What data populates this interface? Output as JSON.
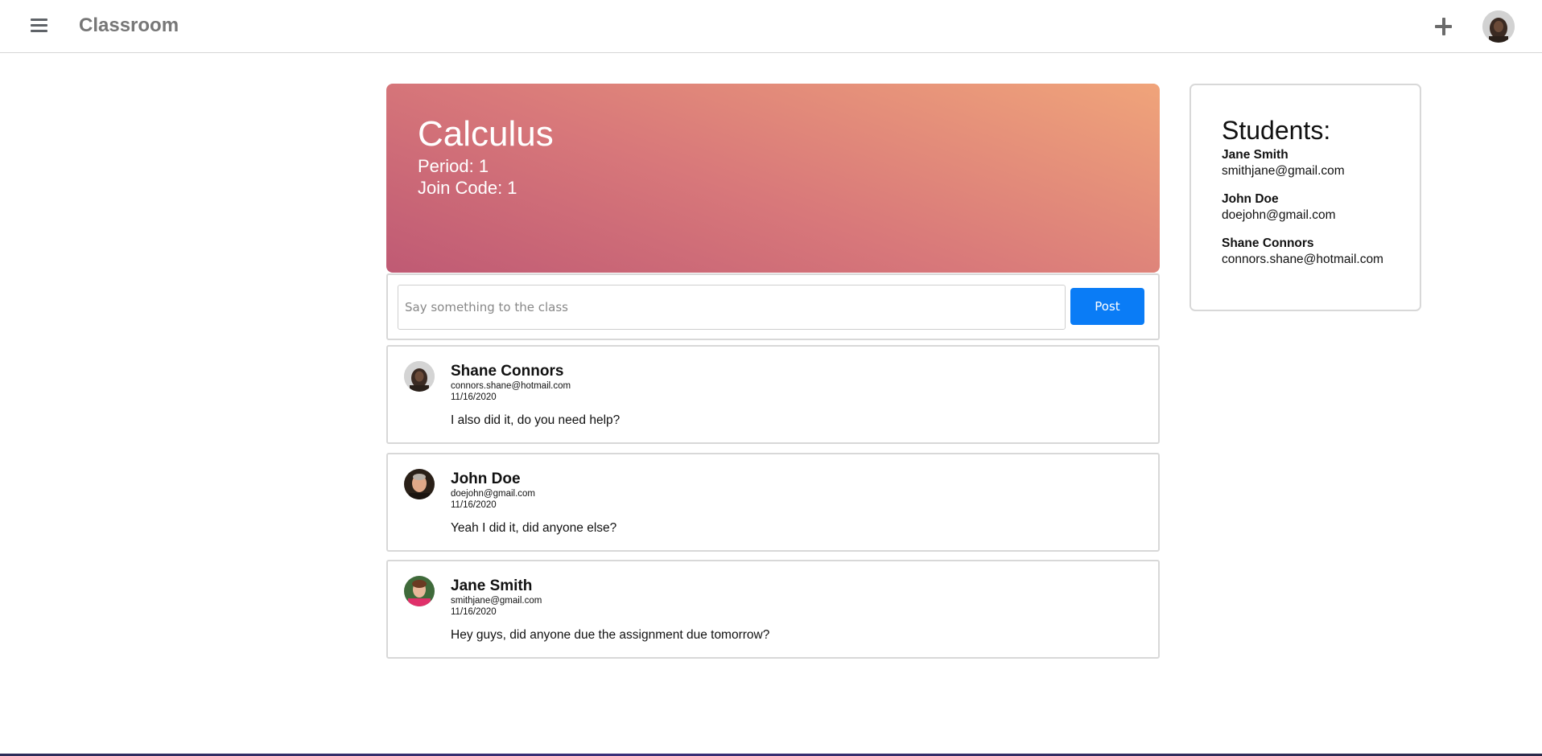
{
  "header": {
    "app_title": "Classroom",
    "menu_icon": "hamburger-menu-icon",
    "add_icon": "plus-icon",
    "avatar_icon": "user-avatar"
  },
  "classroom": {
    "name": "Calculus",
    "period": "Period: 1",
    "join_code": "Join Code: 1",
    "banner_colors": [
      "#bf5a74",
      "#d8787a",
      "#f0a47a"
    ]
  },
  "compose": {
    "placeholder": "Say something to the class",
    "post_label": "Post",
    "post_color": "#0a7cf6"
  },
  "posts": [
    {
      "author": "Shane Connors",
      "email": "connors.shane@hotmail.com",
      "date": "11/16/2020",
      "body": "I also did it, do you need help?"
    },
    {
      "author": "John Doe",
      "email": "doejohn@gmail.com",
      "date": "11/16/2020",
      "body": "Yeah I did it, did anyone else?"
    },
    {
      "author": "Jane Smith",
      "email": "smithjane@gmail.com",
      "date": "11/16/2020",
      "body": "Hey guys, did anyone due the assignment due tomorrow?"
    }
  ],
  "students": {
    "heading": "Students:",
    "list": [
      {
        "name": "Jane Smith",
        "email": "smithjane@gmail.com"
      },
      {
        "name": "John Doe",
        "email": "doejohn@gmail.com"
      },
      {
        "name": "Shane Connors",
        "email": "connors.shane@hotmail.com"
      }
    ]
  }
}
